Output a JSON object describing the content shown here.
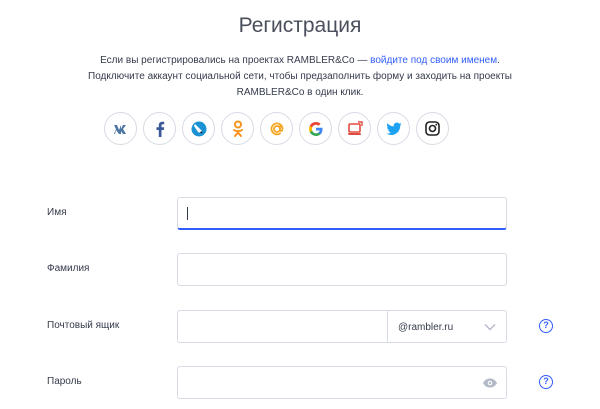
{
  "page": {
    "title": "Регистрация"
  },
  "intro": {
    "text_before_link": "Если вы регистрировались на проектах RAMBLER&Co — ",
    "link": "войдите под своим именем",
    "text_after_link": ".",
    "line2": "Подключите аккаунт социальной сети, чтобы предзаполнить форму и заходить на проекты RAMBLER&Co в один клик."
  },
  "socials": [
    {
      "name": "vk-icon",
      "glyph": "vk",
      "color": "#4c75a3"
    },
    {
      "name": "facebook-icon",
      "glyph": "f",
      "color": "#3b5998"
    },
    {
      "name": "livejournal-icon",
      "glyph": "lj",
      "color": "#1a92d3"
    },
    {
      "name": "odnoklassniki-icon",
      "glyph": "ok",
      "color": "#f7931e"
    },
    {
      "name": "mailru-icon",
      "glyph": "@",
      "color": "#f5a623"
    },
    {
      "name": "google-icon",
      "glyph": "G",
      "color": "#4285f4"
    },
    {
      "name": "moimir-icon",
      "glyph": "mm",
      "color": "#e04b3f"
    },
    {
      "name": "twitter-icon",
      "glyph": "tw",
      "color": "#1da1f2"
    },
    {
      "name": "instagram-icon",
      "glyph": "ig",
      "color": "#222222"
    }
  ],
  "form": {
    "first_name": {
      "label": "Имя",
      "value": ""
    },
    "last_name": {
      "label": "Фамилия",
      "value": ""
    },
    "mailbox": {
      "label": "Почтовый ящик",
      "value": "",
      "domain": "@rambler.ru",
      "help": "?"
    },
    "password": {
      "label": "Пароль",
      "value": "",
      "help": "?"
    }
  }
}
